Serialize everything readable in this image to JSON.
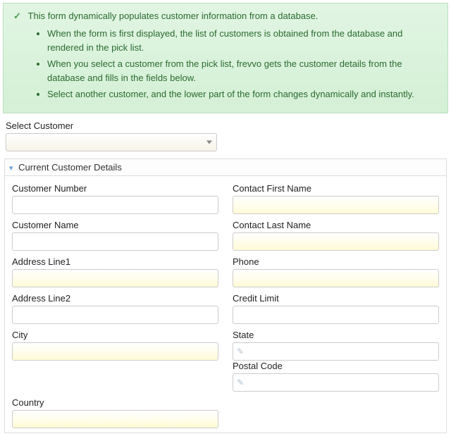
{
  "info": {
    "lead": "This form dynamically populates customer information from a database.",
    "bullets": [
      "When the form is first displayed, the list of customers is obtained from the database and rendered in the pick list.",
      "When you select a customer from the pick list, frevvo gets the customer details from the database and fills in the fields below.",
      "Select another customer, and the lower part of the form changes dynamically and instantly."
    ]
  },
  "selectCustomer": {
    "label": "Select Customer",
    "value": ""
  },
  "section": {
    "title": "Current Customer Details"
  },
  "fields": {
    "customerNumber": {
      "label": "Customer Number",
      "value": ""
    },
    "customerName": {
      "label": "Customer Name",
      "value": ""
    },
    "addressLine1": {
      "label": "Address Line1",
      "value": ""
    },
    "addressLine2": {
      "label": "Address Line2",
      "value": ""
    },
    "city": {
      "label": "City",
      "value": ""
    },
    "country": {
      "label": "Country",
      "value": ""
    },
    "contactFirstName": {
      "label": "Contact First Name",
      "value": ""
    },
    "contactLastName": {
      "label": "Contact Last Name",
      "value": ""
    },
    "phone": {
      "label": "Phone",
      "value": ""
    },
    "creditLimit": {
      "label": "Credit Limit",
      "value": ""
    },
    "state": {
      "label": "State",
      "value": ""
    },
    "postalCode": {
      "label": "Postal Code",
      "value": ""
    }
  }
}
